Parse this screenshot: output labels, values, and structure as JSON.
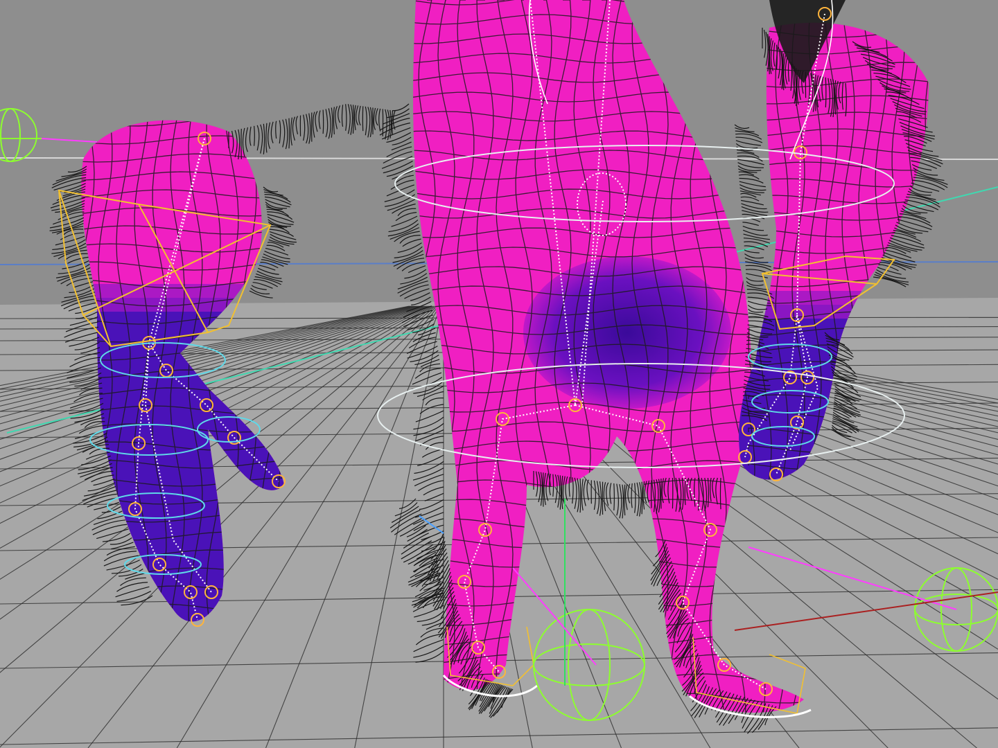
{
  "viewport": {
    "view": "perspective",
    "background_color": "#8e8e8e",
    "floor_color": "#a7a7a7",
    "grid_color": "#2b2b2b"
  },
  "model": {
    "mesh_color": "#f01fc2",
    "weight_color": "#4a12b8",
    "wire_color": "#1c1c1c",
    "fur_color": "#151515",
    "bone_color": "#ffffff",
    "joint_color": "#ffb43c"
  },
  "controls": {
    "ik_handle_color": "#f2c030",
    "pole_control_color": "#8dff2e",
    "foot_control_color": "#ffffff",
    "spline_control_color": "#5fd8e8"
  },
  "axes": {
    "x_color": "#ff3cff",
    "y_color": "#30e060",
    "z_color": "#4aa0ff"
  }
}
